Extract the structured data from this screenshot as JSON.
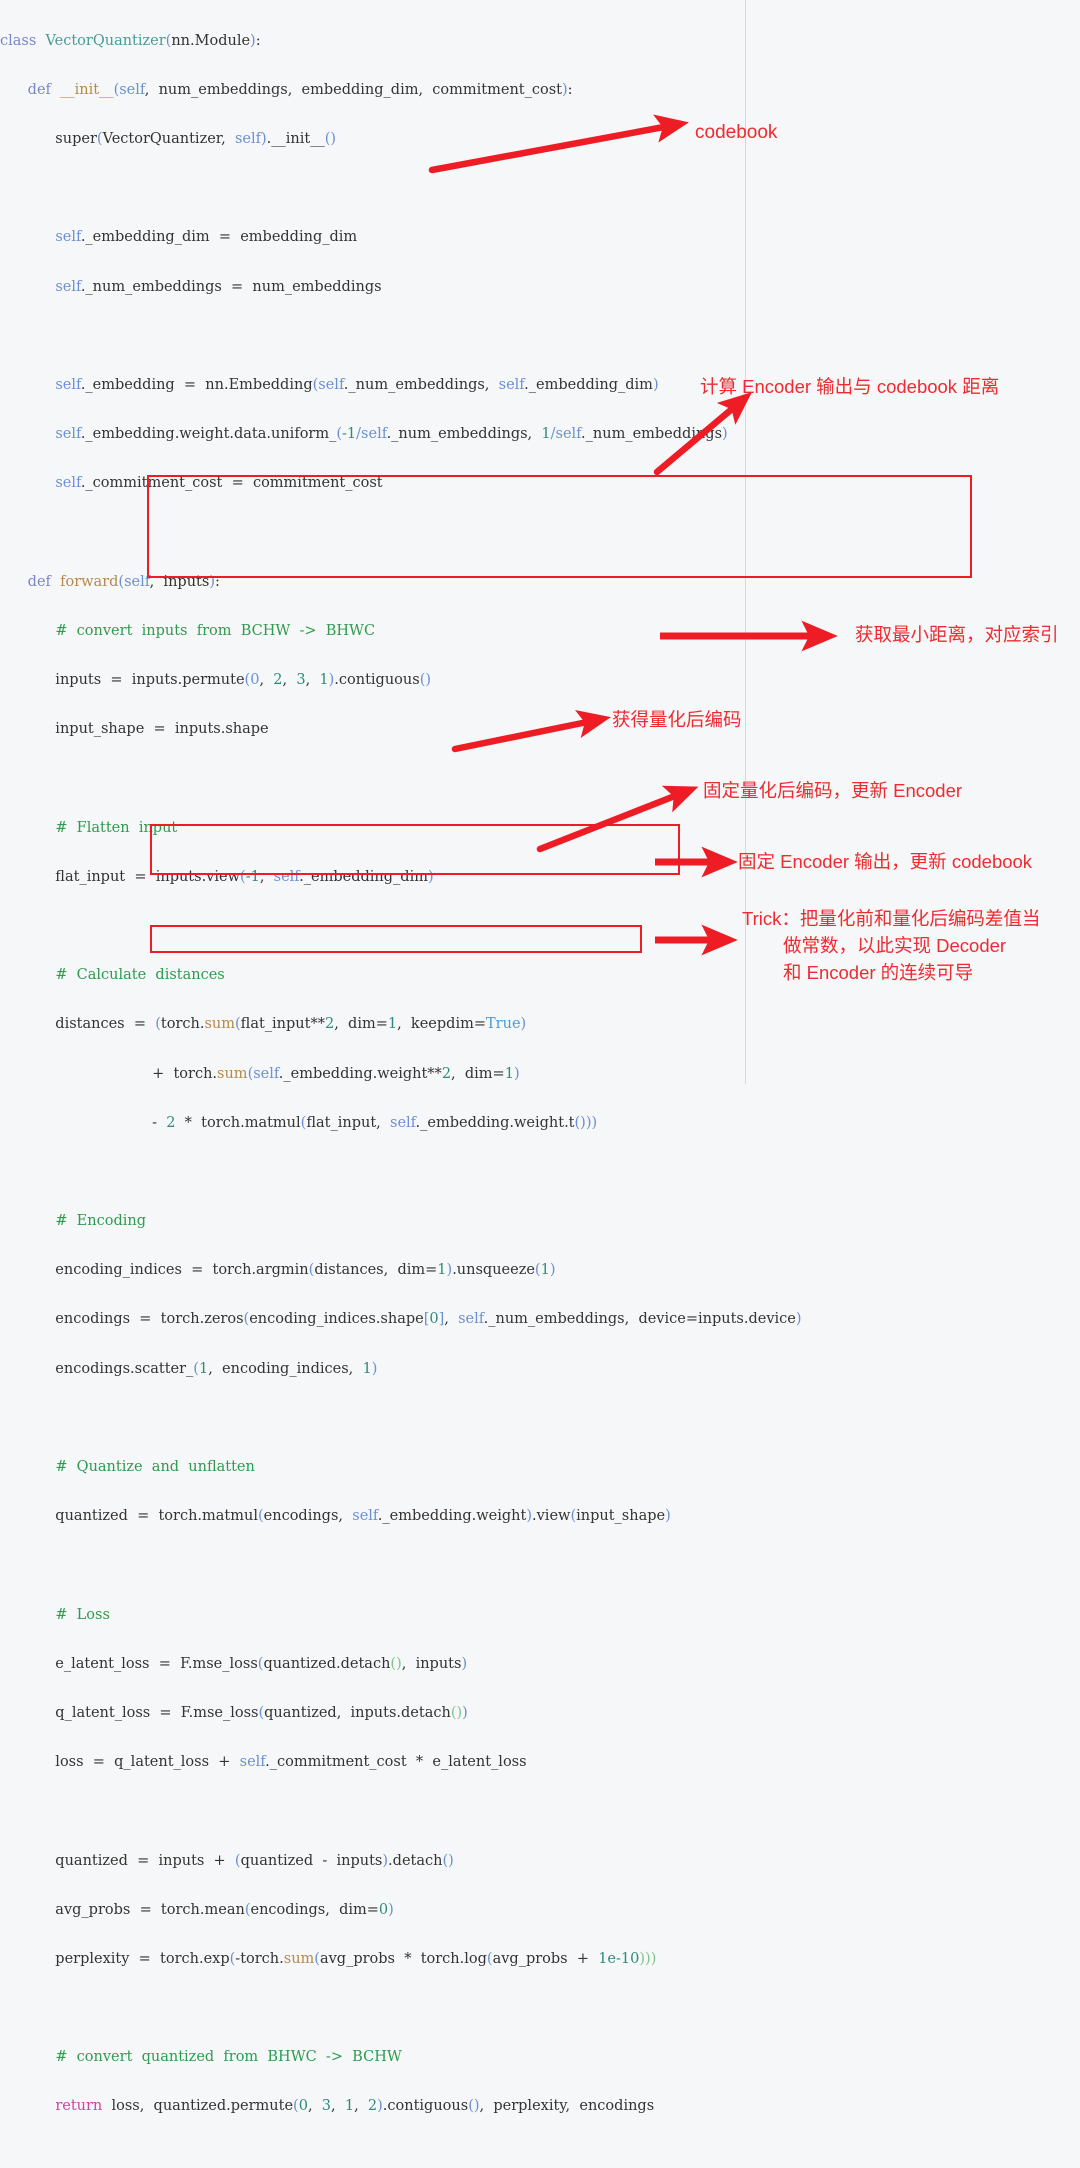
{
  "meta": {
    "kind": "annotated-code-screenshot",
    "language": "python",
    "accent_color": "#ee2b30",
    "box_color": "#ee1c24",
    "background": "#f6f7f8"
  },
  "code_lines": [
    "class  VectorQuantizer(nn.Module):",
    "      def  __init__(self,  num_embeddings,  embedding_dim,  commitment_cost):",
    "            super(VectorQuantizer,  self).__init__()",
    "",
    "            self._embedding_dim  =  embedding_dim",
    "            self._num_embeddings  =  num_embeddings",
    "",
    "            self._embedding  =  nn.Embedding(self._num_embeddings,  self._embedding_dim)",
    "            self._embedding.weight.data.uniform_(-1/self._num_embeddings,  1/self._num_embeddings)",
    "            self._commitment_cost  =  commitment_cost",
    "",
    "      def  forward(self,  inputs):",
    "            #  convert  inputs  from  BCHW  ->  BHWC",
    "            inputs  =  inputs.permute(0,  2,  3,  1).contiguous()",
    "            input_shape  =  inputs.shape",
    "",
    "            #  Flatten  input",
    "            flat_input  =  inputs.view(-1,  self._embedding_dim)",
    "",
    "            #  Calculate  distances",
    "            distances  =  (torch.sum(flat_input**2,  dim=1,  keepdim=True)",
    "                                +  torch.sum(self._embedding.weight**2,  dim=1)",
    "                                -  2  *  torch.matmul(flat_input,  self._embedding.weight.t()))",
    "",
    "            #  Encoding",
    "            encoding_indices  =  torch.argmin(distances,  dim=1).unsqueeze(1)",
    "            encodings  =  torch.zeros(encoding_indices.shape[0],  self._num_embeddings,  device=inputs.device)",
    "            encodings.scatter_(1,  encoding_indices,  1)",
    "",
    "            #  Quantize  and  unflatten",
    "            quantized  =  torch.matmul(encodings,  self._embedding.weight).view(input_shape)",
    "",
    "            #  Loss",
    "            e_latent_loss  =  F.mse_loss(quantized.detach(),  inputs)",
    "            q_latent_loss  =  F.mse_loss(quantized,  inputs.detach())",
    "            loss  =  q_latent_loss  +  self._commitment_cost  *  e_latent_loss",
    "",
    "            quantized  =  inputs  +  (quantized  -  inputs).detach()",
    "            avg_probs  =  torch.mean(encodings,  dim=0)",
    "            perplexity  =  torch.exp(-torch.sum(avg_probs  *  torch.log(avg_probs  +  1e-10)))",
    "",
    "            #  convert  quantized  from  BHWC  ->  BCHW",
    "            return  loss,  quantized.permute(0,  3,  1,  2).contiguous(),  perplexity,  encodings"
  ],
  "annotations": [
    {
      "id": "codebook",
      "text": "codebook"
    },
    {
      "id": "distance",
      "text": "计算 Encoder 输出与 codebook 距离"
    },
    {
      "id": "argmin",
      "text": "获取最小距离，对应索引"
    },
    {
      "id": "quantized-code",
      "text": "获得量化后编码"
    },
    {
      "id": "update-encoder",
      "text": "固定量化后编码，更新 Encoder"
    },
    {
      "id": "update-codebook",
      "text": "固定 Encoder 输出，更新 codebook"
    },
    {
      "id": "trick-l1",
      "text": "Trick：把量化前和量化后编码差值当"
    },
    {
      "id": "trick-l2",
      "text": "做常数，以此实现 Decoder"
    },
    {
      "id": "trick-l3",
      "text": "和 Encoder 的连续可导"
    }
  ]
}
